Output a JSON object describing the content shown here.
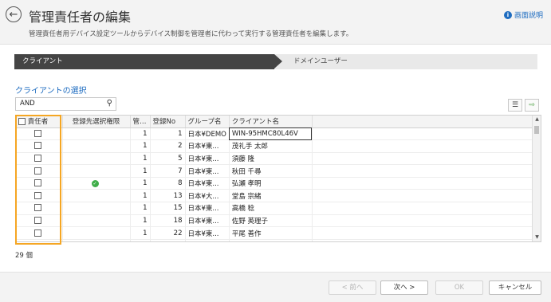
{
  "header": {
    "title": "管理責任者の編集",
    "subtitle": "管理責任者用デバイス設定ツールからデバイス制御を管理者に代わって実行する管理責任者を編集します。",
    "help_label": "画面説明"
  },
  "steps": [
    "クライアント",
    "ドメインユーザー"
  ],
  "section_title": "クライアントの選択",
  "search": {
    "value": "AND"
  },
  "table": {
    "columns": [
      "責任者",
      "登録先選択権限",
      "管…",
      "登録No",
      "グループ名",
      "クライアント名"
    ],
    "rows": [
      {
        "kan": "1",
        "no": "1",
        "group": "日本¥DEMO",
        "client": "WIN-95HMC80L46V",
        "perm": false
      },
      {
        "kan": "1",
        "no": "2",
        "group": "日本¥東...",
        "client": "茂礼手 太郎",
        "perm": false
      },
      {
        "kan": "1",
        "no": "5",
        "group": "日本¥東...",
        "client": "須藤 隆",
        "perm": false
      },
      {
        "kan": "1",
        "no": "7",
        "group": "日本¥東...",
        "client": "秋田 千尋",
        "perm": false
      },
      {
        "kan": "1",
        "no": "8",
        "group": "日本¥東...",
        "client": "弘瀬 孝明",
        "perm": true
      },
      {
        "kan": "1",
        "no": "13",
        "group": "日本¥大...",
        "client": "堂島 宗緒",
        "perm": false
      },
      {
        "kan": "1",
        "no": "15",
        "group": "日本¥東...",
        "client": "高橋 稔",
        "perm": false
      },
      {
        "kan": "1",
        "no": "18",
        "group": "日本¥東...",
        "client": "佐野 英理子",
        "perm": false
      },
      {
        "kan": "1",
        "no": "22",
        "group": "日本¥東...",
        "client": "平尾 善作",
        "perm": false
      },
      {
        "kan": "1",
        "no": "24",
        "group": "日本¥名...",
        "client": "小林 由吉",
        "perm": false
      }
    ]
  },
  "count_label": "29 個",
  "footer": {
    "prev": "< 前へ",
    "next": "次へ >",
    "ok": "OK",
    "cancel": "キャンセル"
  },
  "colors": {
    "accent": "#1e6cc0",
    "highlight": "#f5a623",
    "step_active": "#444444",
    "check": "#3fae49"
  }
}
